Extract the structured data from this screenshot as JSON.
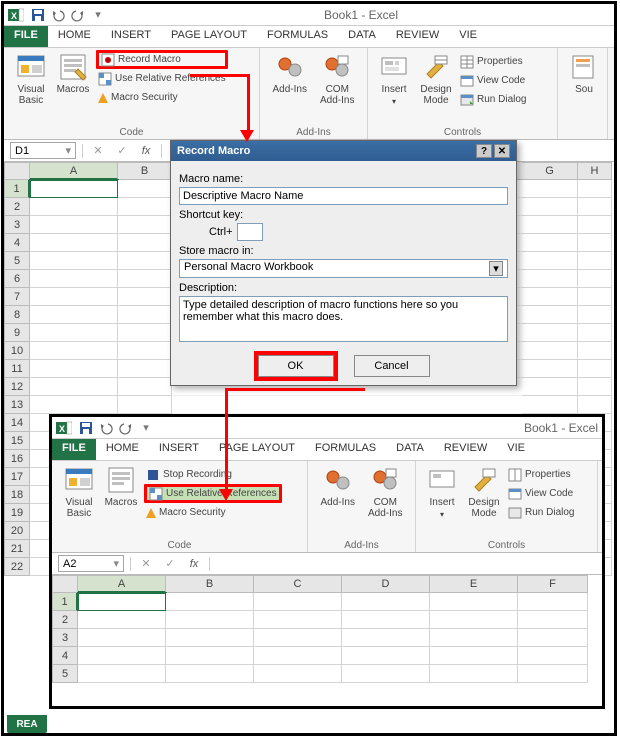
{
  "app_title": "Book1 - Excel",
  "app_title2": "Book1 - Excel",
  "tabs1": {
    "file": "FILE",
    "home": "HOME",
    "insert": "INSERT",
    "pagelayout": "PAGE LAYOUT",
    "formulas": "FORMULAS",
    "data": "DATA",
    "review": "REVIEW",
    "view": "VIE"
  },
  "tabs2": {
    "file": "FILE",
    "home": "HOME",
    "insert": "INSERT",
    "pagelayout": "PAGE LAYOUT",
    "formulas": "FORMULAS",
    "data": "DATA",
    "review": "REVIEW",
    "view": "VIE"
  },
  "ribbon1": {
    "visual_basic": "Visual\nBasic",
    "macros": "Macros",
    "record_macro": "Record Macro",
    "use_relative": "Use Relative References",
    "macro_security": "Macro Security",
    "group_code": "Code",
    "addins": "Add-Ins",
    "com_addins": "COM\nAdd-Ins",
    "group_addins": "Add-Ins",
    "insert": "Insert",
    "design_mode": "Design\nMode",
    "properties": "Properties",
    "view_code": "View Code",
    "run_dialog": "Run Dialog",
    "group_controls": "Controls",
    "source": "Sou"
  },
  "ribbon2": {
    "visual_basic": "Visual\nBasic",
    "macros": "Macros",
    "stop_recording": "Stop Recording",
    "use_relative": "Use Relative References",
    "macro_security": "Macro Security",
    "group_code": "Code",
    "addins": "Add-Ins",
    "com_addins": "COM\nAdd-Ins",
    "group_addins": "Add-Ins",
    "insert": "Insert",
    "design_mode": "Design\nMode",
    "properties": "Properties",
    "view_code": "View Code",
    "run_dialog": "Run Dialog",
    "group_controls": "Controls"
  },
  "namebox1": "D1",
  "namebox2": "A2",
  "cols1": [
    "A",
    "B",
    "G",
    "H"
  ],
  "rows1": [
    "1",
    "2",
    "3",
    "4",
    "5",
    "6",
    "7",
    "8",
    "9",
    "10",
    "11",
    "12",
    "13",
    "14",
    "15",
    "16",
    "17",
    "18",
    "19",
    "20",
    "21",
    "22"
  ],
  "cols2": [
    "A",
    "B",
    "C",
    "D",
    "E",
    "F"
  ],
  "rows2": [
    "1",
    "2",
    "3",
    "4",
    "5"
  ],
  "dialog": {
    "title": "Record Macro",
    "macro_name_label": "Macro name:",
    "macro_name_value": "Descriptive Macro Name",
    "shortcut_label": "Shortcut key:",
    "shortcut_prefix": "Ctrl+",
    "store_label": "Store macro in:",
    "store_value": "Personal Macro Workbook",
    "description_label": "Description:",
    "description_value": "Type detailed description of macro functions here so you remember what this macro does.",
    "ok": "OK",
    "cancel": "Cancel"
  },
  "fx_label": "fx",
  "sheettab": "REA"
}
